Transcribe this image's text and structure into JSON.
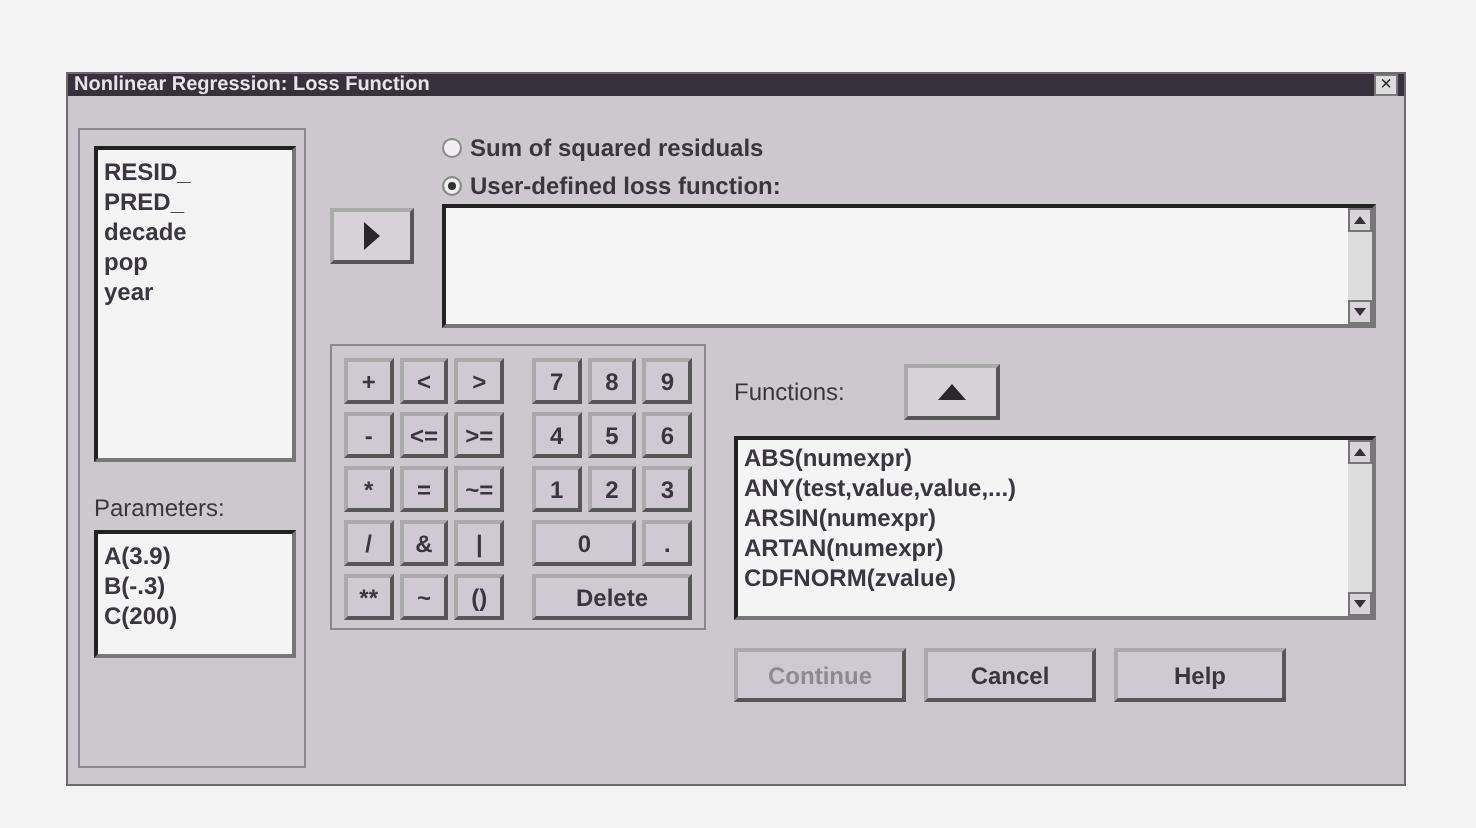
{
  "window": {
    "title": "Nonlinear Regression: Loss Function",
    "close": "×"
  },
  "variables": [
    "RESID_",
    "PRED_",
    "decade",
    "pop",
    "year"
  ],
  "parameters_label": "Parameters:",
  "parameters": [
    "A(3.9)",
    "B(-.3)",
    "C(200)"
  ],
  "loss_options": [
    {
      "label": "Sum of squared residuals",
      "selected": false
    },
    {
      "label": "User-defined loss function:",
      "selected": true
    }
  ],
  "keypad": [
    {
      "left": [
        {
          "label": "+",
          "kind": "single"
        },
        {
          "label": "<",
          "kind": "single"
        },
        {
          "label": ">",
          "kind": "single"
        }
      ],
      "right": [
        {
          "label": "7",
          "kind": "single"
        },
        {
          "label": "8",
          "kind": "single"
        },
        {
          "label": "9",
          "kind": "single"
        }
      ]
    },
    {
      "left": [
        {
          "label": "-",
          "kind": "single"
        },
        {
          "label": "<=",
          "kind": "single"
        },
        {
          "label": ">=",
          "kind": "single"
        }
      ],
      "right": [
        {
          "label": "4",
          "kind": "single"
        },
        {
          "label": "5",
          "kind": "single"
        },
        {
          "label": "6",
          "kind": "single"
        }
      ]
    },
    {
      "left": [
        {
          "label": "*",
          "kind": "single"
        },
        {
          "label": "=",
          "kind": "single"
        },
        {
          "label": "~=",
          "kind": "single"
        }
      ],
      "right": [
        {
          "label": "1",
          "kind": "single"
        },
        {
          "label": "2",
          "kind": "single"
        },
        {
          "label": "3",
          "kind": "single"
        }
      ]
    },
    {
      "left": [
        {
          "label": "/",
          "kind": "single"
        },
        {
          "label": "&",
          "kind": "single"
        },
        {
          "label": "|",
          "kind": "single"
        }
      ],
      "right": [
        {
          "label": "0",
          "kind": "double"
        },
        {
          "label": ".",
          "kind": "single"
        }
      ]
    },
    {
      "left": [
        {
          "label": "**",
          "kind": "single"
        },
        {
          "label": "~",
          "kind": "single"
        },
        {
          "label": "()",
          "kind": "single"
        }
      ],
      "right": [
        {
          "label": "Delete",
          "kind": "triple"
        }
      ]
    }
  ],
  "functions_label": "Functions:",
  "functions": [
    "ABS(numexpr)",
    "ANY(test,value,value,...)",
    "ARSIN(numexpr)",
    "ARTAN(numexpr)",
    "CDFNORM(zvalue)"
  ],
  "buttons": [
    {
      "label": "Continue",
      "disabled": true
    },
    {
      "label": "Cancel",
      "disabled": false
    },
    {
      "label": "Help",
      "disabled": false
    }
  ]
}
